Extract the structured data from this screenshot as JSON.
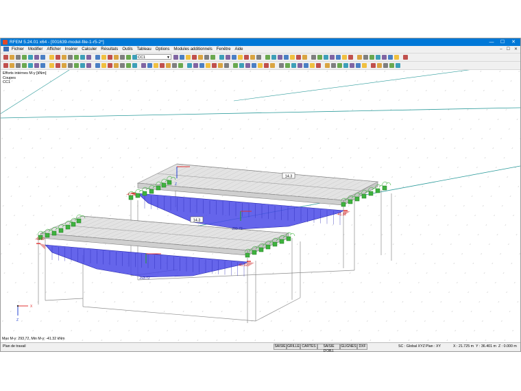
{
  "window": {
    "title": "RFEM 5.24.01 x64 - [001639-model-file-1-r5-2*]",
    "controls": [
      "—",
      "☐",
      "✕"
    ]
  },
  "menu": {
    "items": [
      "Fichier",
      "Modifier",
      "Afficher",
      "Insérer",
      "Calculer",
      "Résultats",
      "Outils",
      "Tableau",
      "Options",
      "Modules additionnels",
      "Fenêtre",
      "Aide"
    ],
    "mdi_controls": [
      "–",
      "☐",
      "✕"
    ]
  },
  "toolbar": {
    "loadcase": "CC1"
  },
  "viewport": {
    "info": [
      "Efforts internes M-y [kNm]",
      "Coupes",
      "CC1"
    ],
    "annotations": {
      "value_back": "14.3",
      "value_front": "14.3",
      "max_back": "293.72",
      "max_front": "293.72",
      "min_back_left": "-41.32",
      "min_back_right": "-41.32",
      "min_front_left": "-41.32",
      "min_front_right": "-41.32"
    },
    "axes": {
      "x": "X",
      "z": "Z"
    },
    "status_message": "Max M-y: 293.72, Min M-y: -41.32 kNm",
    "colors": {
      "diagram_fill": "#4a4ae8",
      "support": "#3fb23f",
      "grid_line": "#2a9a9a"
    }
  },
  "statusbar": {
    "left": "Plan de travail",
    "buttons": [
      "SAISIE",
      "GRILLE",
      "CARTES",
      "SAISIE D'OBJ.",
      "GLIGNES",
      "DXF"
    ],
    "sc": "SC : Global XYZ",
    "plan": "Plan : XY",
    "x": "X : 21.725 m",
    "y": "Y : 36.401 m",
    "z": "Z : 0.000 m"
  }
}
